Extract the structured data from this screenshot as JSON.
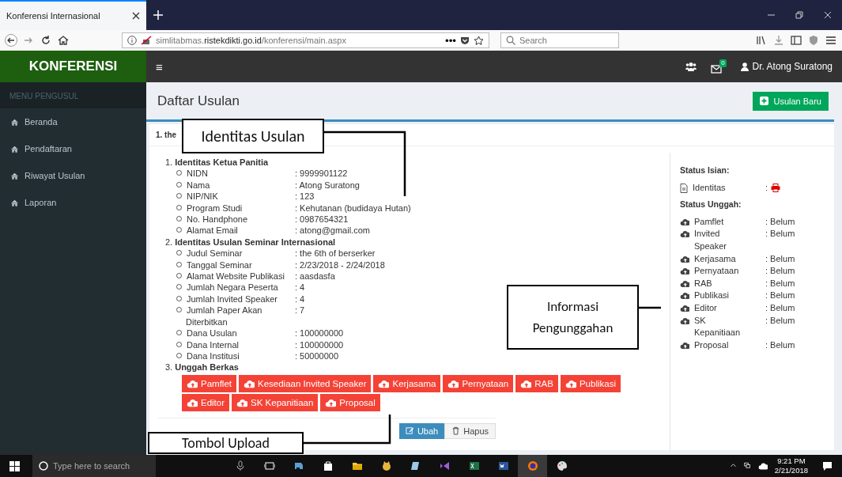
{
  "browser": {
    "tab_title": "Konferensi Internasional",
    "url": {
      "prefix": "simlitabmas.",
      "domain": "ristekdikti.go.id",
      "path": "/konferensi/main.aspx"
    },
    "more": "•••",
    "search_placeholder": "Search"
  },
  "app_header": {
    "brand": "KONFERENSI",
    "menu_glyph": "≡",
    "mail_badge": "0",
    "user": "Dr. Atong Suratong"
  },
  "sidebar": {
    "section": "MENU PENGUSUL",
    "items": [
      {
        "label": "Beranda",
        "kind": "home"
      },
      {
        "label": "Pendaftaran",
        "kind": "home"
      },
      {
        "label": "Riwayat Usulan",
        "kind": "home"
      },
      {
        "label": "Laporan",
        "kind": "home"
      }
    ]
  },
  "page": {
    "title": "Daftar Usulan",
    "new_button": "Usulan Baru",
    "proposal_heading": "1. the",
    "sections": [
      {
        "number": "1.",
        "title": "Identitas Ketua Panitia",
        "fields": [
          {
            "label": "NIDN",
            "value": ": 9999901122"
          },
          {
            "label": "Nama",
            "value": ": Atong Suratong"
          },
          {
            "label": "NIP/NIK",
            "value": ": 123"
          },
          {
            "label": "Program Studi",
            "value": ": Kehutanan (budidaya Hutan)"
          },
          {
            "label": "No. Handphone",
            "value": ": 0987654321"
          },
          {
            "label": "Alamat Email",
            "value": ": atong@gmail.com"
          }
        ]
      },
      {
        "number": "2.",
        "title": "Identitas Usulan Seminar Internasional",
        "fields": [
          {
            "label": "Judul Seminar",
            "value": ": the 6th of berserker"
          },
          {
            "label": "Tanggal Seminar",
            "value": ": 2/23/2018 - 2/24/2018"
          },
          {
            "label": "Alamat Website Publikasi",
            "value": ": aasdasfa"
          },
          {
            "label": "Jumlah Negara Peserta",
            "value": ": 4"
          },
          {
            "label": "Jumlah Invited Speaker",
            "value": ": 4"
          },
          {
            "label": "Jumlah Paper Akan Diterbitkan",
            "value": ": 7"
          },
          {
            "label": "Dana Usulan",
            "value": ": 100000000"
          },
          {
            "label": "Dana Internal",
            "value": ": 100000000"
          },
          {
            "label": "Dana Institusi",
            "value": ": 50000000"
          }
        ]
      },
      {
        "number": "3.",
        "title": "Unggah Berkas"
      }
    ],
    "upload_buttons": [
      "Pamflet",
      "Kesediaan Invited Speaker",
      "Kerjasama",
      "Pernyataan",
      "RAB",
      "Publikasi",
      "Editor",
      "SK Kepanitiaan",
      "Proposal"
    ],
    "actions": [
      {
        "label": "Ubah",
        "kind": "edit"
      },
      {
        "label": "Hapus",
        "kind": "delete"
      }
    ],
    "status_isian": {
      "title": "Status Isian:",
      "items": [
        {
          "label": "Identitas",
          "value": ":"
        }
      ]
    },
    "status_unggah": {
      "title": "Status Unggah:",
      "items": [
        {
          "label": "Pamflet",
          "value": ": Belum"
        },
        {
          "label": "Invited Speaker",
          "value": ": Belum"
        },
        {
          "label": "Kerjasama",
          "value": ": Belum"
        },
        {
          "label": "Pernyataan",
          "value": ": Belum"
        },
        {
          "label": "RAB",
          "value": ": Belum"
        },
        {
          "label": "Publikasi",
          "value": ": Belum"
        },
        {
          "label": "Editor",
          "value": ": Belum"
        },
        {
          "label": "SK Kepanitiaan",
          "value": ": Belum"
        },
        {
          "label": "Proposal",
          "value": ": Belum"
        }
      ]
    }
  },
  "taskbar": {
    "search_placeholder": "Type here to search",
    "time": "9:21 PM",
    "date": "2/21/2018"
  },
  "annotations": [
    {
      "text": "Identitas Usulan"
    },
    {
      "text": "Informasi Pengunggahan"
    },
    {
      "text": "Tombol Upload"
    }
  ]
}
